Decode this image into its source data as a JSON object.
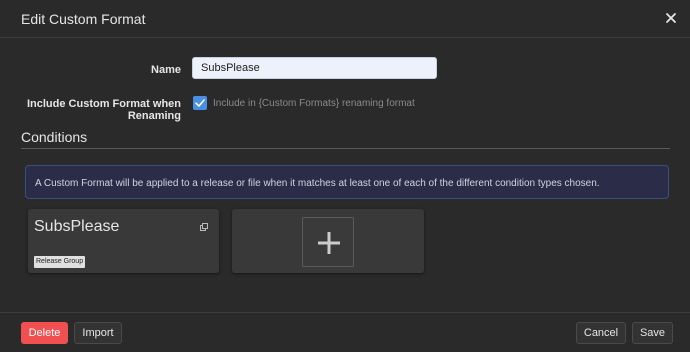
{
  "header": {
    "title": "Edit Custom Format",
    "close_icon": "close-icon"
  },
  "form": {
    "name_label": "Name",
    "name_value": "SubsPlease",
    "include_label": "Include Custom Format when Renaming",
    "include_checked": true,
    "include_help": "Include in {Custom Formats} renaming format"
  },
  "conditions": {
    "title": "Conditions",
    "info": "A Custom Format will be applied to a release or file when it matches at least one of each of the different condition types chosen.",
    "items": [
      {
        "name": "SubsPlease",
        "type": "Release Group",
        "icon": "clone-icon"
      }
    ],
    "add_icon": "plus-icon"
  },
  "footer": {
    "delete_label": "Delete",
    "import_label": "Import",
    "cancel_label": "Cancel",
    "save_label": "Save"
  },
  "colors": {
    "background": "#2a2a2a",
    "accent": "#4a90e2",
    "danger": "#f05050",
    "info_bg": "#2b2d48"
  }
}
